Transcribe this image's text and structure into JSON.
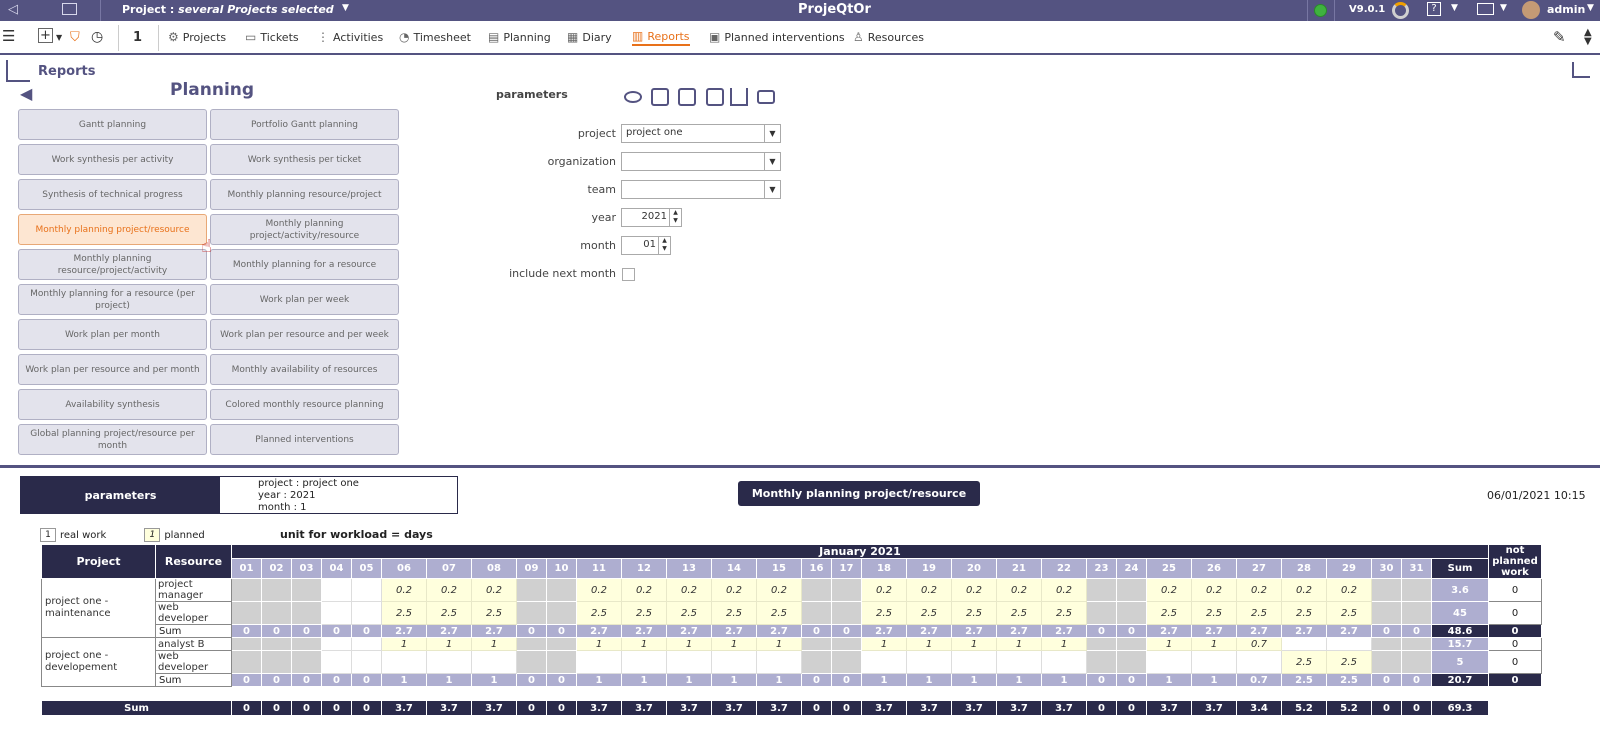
{
  "topbar": {
    "project_label": "Project :",
    "project_value": "several Projects selected",
    "app_title": "ProjeQtOr",
    "version": "V9.0.1",
    "user": "admin"
  },
  "toolbar": {
    "count": "1",
    "items": [
      "Projects",
      "Tickets",
      "Activities",
      "Timesheet",
      "Planning",
      "Diary",
      "Reports",
      "Planned interventions",
      "Resources"
    ]
  },
  "page": {
    "title": "Reports",
    "section_title": "Planning"
  },
  "report_buttons": [
    "Gantt planning",
    "Portfolio Gantt planning",
    "Work synthesis per activity",
    "Work synthesis per ticket",
    "Synthesis of technical progress",
    "Monthly planning resource/project",
    "Monthly planning project/resource",
    "Monthly planning project/activity/resource",
    "Monthly planning resource/project/activity",
    "Monthly planning for a resource",
    "Monthly planning for a resource (per project)",
    "Work plan per week",
    "Work plan per month",
    "Work plan per resource and per week",
    "Work plan per resource and per month",
    "Monthly availability of resources",
    "Availability synthesis",
    "Colored monthly resource planning",
    "Global planning project/resource per month",
    "Planned interventions"
  ],
  "parameters": {
    "header": "parameters",
    "fields": [
      {
        "label": "project",
        "value": "project one"
      },
      {
        "label": "organization",
        "value": ""
      },
      {
        "label": "team",
        "value": ""
      },
      {
        "label": "year",
        "value": "2021"
      },
      {
        "label": "month",
        "value": "01"
      },
      {
        "label": "include next month",
        "value": ""
      }
    ]
  },
  "report": {
    "params_label": "parameters",
    "param_lines": [
      "project : project one",
      "year : 2021",
      "month : 1"
    ],
    "title": "Monthly planning project/resource",
    "date": "06/01/2021 10:15",
    "legend_real": "real work",
    "legend_planned": "planned",
    "legend_num": "1",
    "unit": "unit for workload = days",
    "col_project": "Project",
    "col_resource": "Resource",
    "month_title": "January 2021",
    "col_sum": "Sum",
    "col_not_planned": "not planned work",
    "days": [
      "01",
      "02",
      "03",
      "04",
      "05",
      "06",
      "07",
      "08",
      "09",
      "10",
      "11",
      "12",
      "13",
      "14",
      "15",
      "16",
      "17",
      "18",
      "19",
      "20",
      "21",
      "22",
      "23",
      "24",
      "25",
      "26",
      "27",
      "28",
      "29",
      "30",
      "31"
    ],
    "weekend_days": [
      "01",
      "02",
      "03",
      "09",
      "10",
      "16",
      "17",
      "23",
      "24",
      "30",
      "31"
    ],
    "groups": [
      {
        "project": "project one - maintenance",
        "rows": [
          {
            "resource": "project manager",
            "values": [
              "",
              "",
              "",
              "",
              "",
              "0.2",
              "0.2",
              "0.2",
              "",
              "",
              "0.2",
              "0.2",
              "0.2",
              "0.2",
              "0.2",
              "",
              "",
              "0.2",
              "0.2",
              "0.2",
              "0.2",
              "0.2",
              "",
              "",
              "0.2",
              "0.2",
              "0.2",
              "0.2",
              "0.2",
              "",
              ""
            ],
            "sum": "3.6",
            "not_planned": "0"
          },
          {
            "resource": "web developer",
            "values": [
              "",
              "",
              "",
              "",
              "",
              "2.5",
              "2.5",
              "2.5",
              "",
              "",
              "2.5",
              "2.5",
              "2.5",
              "2.5",
              "2.5",
              "",
              "",
              "2.5",
              "2.5",
              "2.5",
              "2.5",
              "2.5",
              "",
              "",
              "2.5",
              "2.5",
              "2.5",
              "2.5",
              "2.5",
              "",
              ""
            ],
            "sum": "45",
            "not_planned": "0"
          }
        ],
        "sum_label": "Sum",
        "sum_values": [
          "0",
          "0",
          "0",
          "0",
          "0",
          "2.7",
          "2.7",
          "2.7",
          "0",
          "0",
          "2.7",
          "2.7",
          "2.7",
          "2.7",
          "2.7",
          "0",
          "0",
          "2.7",
          "2.7",
          "2.7",
          "2.7",
          "2.7",
          "0",
          "0",
          "2.7",
          "2.7",
          "2.7",
          "2.7",
          "2.7",
          "0",
          "0"
        ],
        "sum_total": "48.6",
        "sum_not_planned": "0"
      },
      {
        "project": "project one - developement",
        "rows": [
          {
            "resource": "analyst B",
            "values": [
              "",
              "",
              "",
              "",
              "",
              "1",
              "1",
              "1",
              "",
              "",
              "1",
              "1",
              "1",
              "1",
              "1",
              "",
              "",
              "1",
              "1",
              "1",
              "1",
              "1",
              "",
              "",
              "1",
              "1",
              "0.7",
              "",
              "",
              "",
              ""
            ],
            "sum": "15.7",
            "not_planned": "0"
          },
          {
            "resource": "web developer",
            "values": [
              "",
              "",
              "",
              "",
              "",
              "",
              "",
              "",
              "",
              "",
              "",
              "",
              "",
              "",
              "",
              "",
              "",
              "",
              "",
              "",
              "",
              "",
              "",
              "",
              "",
              "",
              "",
              "2.5",
              "2.5",
              "",
              ""
            ],
            "sum": "5",
            "not_planned": "0"
          }
        ],
        "sum_label": "Sum",
        "sum_values": [
          "0",
          "0",
          "0",
          "0",
          "0",
          "1",
          "1",
          "1",
          "0",
          "0",
          "1",
          "1",
          "1",
          "1",
          "1",
          "0",
          "0",
          "1",
          "1",
          "1",
          "1",
          "1",
          "0",
          "0",
          "1",
          "1",
          "0.7",
          "2.5",
          "2.5",
          "0",
          "0"
        ],
        "sum_total": "20.7",
        "sum_not_planned": "0"
      }
    ],
    "total_label": "Sum",
    "total_values": [
      "0",
      "0",
      "0",
      "0",
      "0",
      "3.7",
      "3.7",
      "3.7",
      "0",
      "0",
      "3.7",
      "3.7",
      "3.7",
      "3.7",
      "3.7",
      "0",
      "0",
      "3.7",
      "3.7",
      "3.7",
      "3.7",
      "3.7",
      "0",
      "0",
      "3.7",
      "3.7",
      "3.4",
      "5.2",
      "5.2",
      "0",
      "0"
    ],
    "total_sum": "69.3"
  },
  "colors": {
    "primary": "#545381",
    "dark": "#2a2a4a",
    "accent": "#e8711a",
    "planned_bg": "#ffffdd",
    "header_day": "#aeaed0"
  }
}
